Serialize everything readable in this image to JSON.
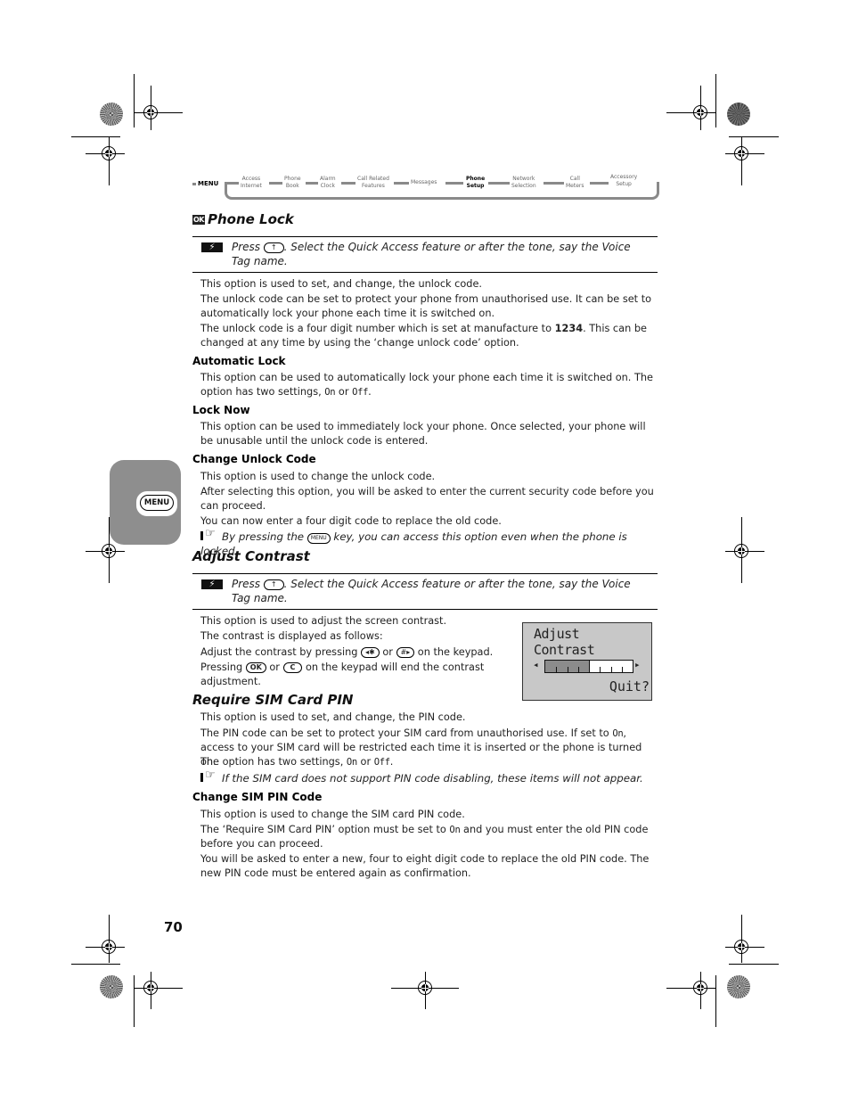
{
  "nav": {
    "menu_label": "MENU",
    "items": [
      {
        "line1": "Access",
        "line2": "Internet"
      },
      {
        "line1": "Phone",
        "line2": "Book"
      },
      {
        "line1": "Alarm",
        "line2": "Clock"
      },
      {
        "line1": "Call Related",
        "line2": "Features"
      },
      {
        "line1": "Messages",
        "line2": ""
      },
      {
        "line1": "Phone",
        "line2": "Setup",
        "active": true
      },
      {
        "line1": "Network",
        "line2": "Selection"
      },
      {
        "line1": "Call",
        "line2": "Meters"
      },
      {
        "line1": "Accessory",
        "line2": "Setup"
      }
    ]
  },
  "phone_lock": {
    "badge": "OK",
    "title": "Phone Lock",
    "quick_access": {
      "press": "Press",
      "key": "↑",
      "rest": ". Select the Quick Access feature or after the tone, say the Voice Tag name."
    },
    "p1": "This option is used to set, and change, the unlock code.",
    "p2": "The unlock code can be set to protect your phone from unauthorised use. It can be set to automatically lock your phone each time it is switched on.",
    "p3_a": "The unlock code is a four digit number which is set at manufacture to ",
    "p3_bold": "1234",
    "p3_b": ". This can be changed at any time by using the ‘change unlock code’ option.",
    "auto_lock": {
      "heading": "Automatic Lock",
      "text_a": "This option can be used to automatically lock your phone each time it is switched on. The option has two settings, ",
      "on": "On",
      "or": " or ",
      "off": "Off",
      "end": "."
    },
    "lock_now": {
      "heading": "Lock Now",
      "text": "This option can be used to immediately lock your phone. Once selected, your phone will be unusable until the unlock code is entered."
    },
    "change_unlock": {
      "heading": "Change Unlock Code",
      "p1": "This option is used to change the unlock code.",
      "p2": "After selecting this option, you will be asked to enter the current security code before you can proceed.",
      "p3": "You can now enter a four digit code to replace the old code.",
      "note_a": "By pressing the ",
      "note_key": "MENU",
      "note_b": " key, you can access this option even when the phone is locked."
    }
  },
  "adjust_contrast": {
    "title": "Adjust Contrast",
    "quick_access": {
      "press": "Press",
      "key": "↑",
      "rest": ". Select the Quick Access feature or after the tone, say the Voice Tag name."
    },
    "p1": "This option is used to adjust the screen contrast.",
    "p2": "The contrast is displayed as follows:",
    "p3_a": "Adjust the contrast by pressing ",
    "key_left": "◂✱",
    "p3_or": " or ",
    "key_right": "#▸",
    "p3_b": " on the keypad.",
    "p4_a": "Pressing ",
    "key_ok": "OK",
    "p4_or": " or ",
    "key_c": "C",
    "p4_b": " on the keypad will end the contrast adjustment.",
    "lcd": {
      "line1": "Adjust",
      "line2": "Contrast",
      "level_fraction": 0.5,
      "softkey": "Quit?"
    }
  },
  "require_sim_pin": {
    "title": "Require SIM Card PIN",
    "p1": "This option is used to set, and change, the PIN code.",
    "p2_a": "The PIN code can be set to protect your SIM card from unauthorised use. If set to ",
    "on": "On",
    "p2_b": ", access to your SIM card will be restricted each time it is inserted or the phone is turned on.",
    "p3_a": "The option has two settings, ",
    "p3_or": " or ",
    "off": "Off",
    "p3_end": ".",
    "note": "If the SIM card does not support PIN code disabling, these items will not appear."
  },
  "change_sim_pin": {
    "heading": "Change SIM PIN Code",
    "p1": "This option is used to change the SIM card PIN code.",
    "p2_a": "The ‘Require SIM Card PIN’ option must be set to ",
    "on": "On",
    "p2_b": " and you must enter the old PIN code before you can proceed.",
    "p3": "You will be asked to enter a new, four to eight digit code to replace the old PIN code. The new PIN code must be entered again as confirmation."
  },
  "side_tab": {
    "label": "MENU"
  },
  "page_number": "70"
}
